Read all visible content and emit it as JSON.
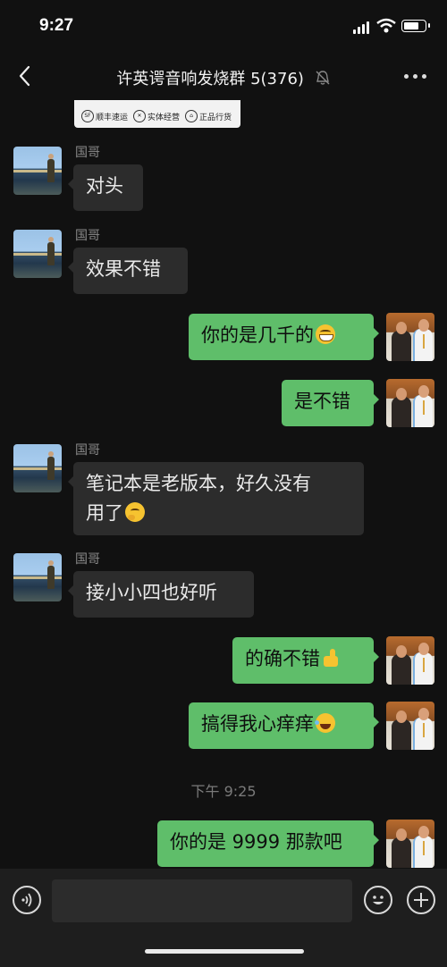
{
  "status_bar": {
    "time": "9:27"
  },
  "header": {
    "title": "许英谔音响发烧群 5(376)"
  },
  "card": {
    "tags": [
      "顺丰速运",
      "实体经营",
      "正品行货"
    ],
    "tag_icons": [
      "SF",
      "✕",
      "⌂"
    ]
  },
  "messages": [
    {
      "side": "left",
      "sender": "国哥",
      "text": "对头"
    },
    {
      "side": "left",
      "sender": "国哥",
      "text": "效果不错"
    },
    {
      "side": "right",
      "text": "你的是几千的",
      "emoji": "grin-emoji"
    },
    {
      "side": "right",
      "text": "是不错"
    },
    {
      "side": "left",
      "sender": "国哥",
      "text_line1": "笔记本是老版本，好久没有",
      "text_line2": "用了",
      "emoji": "thinking-emoji"
    },
    {
      "side": "left",
      "sender": "国哥",
      "text": "接小小四也好听"
    },
    {
      "side": "right",
      "text": "的确不错",
      "emoji": "thumbs-up-emoji"
    },
    {
      "side": "right",
      "text": "搞得我心痒痒",
      "emoji": "laughing-tears-emoji"
    },
    {
      "side": "right",
      "text": "你的是 9999 那款吧"
    }
  ],
  "timestamp": "下午 9:25",
  "icons": {
    "back": "back-arrow-icon",
    "mute": "mute-bell-icon",
    "more": "more-dots-icon",
    "voice": "voice-input-icon",
    "emoji": "emoji-icon",
    "plus": "plus-icon"
  },
  "colors": {
    "background": "#111111",
    "bubble_left": "#2c2c2c",
    "bubble_right": "#5fbe6a"
  }
}
